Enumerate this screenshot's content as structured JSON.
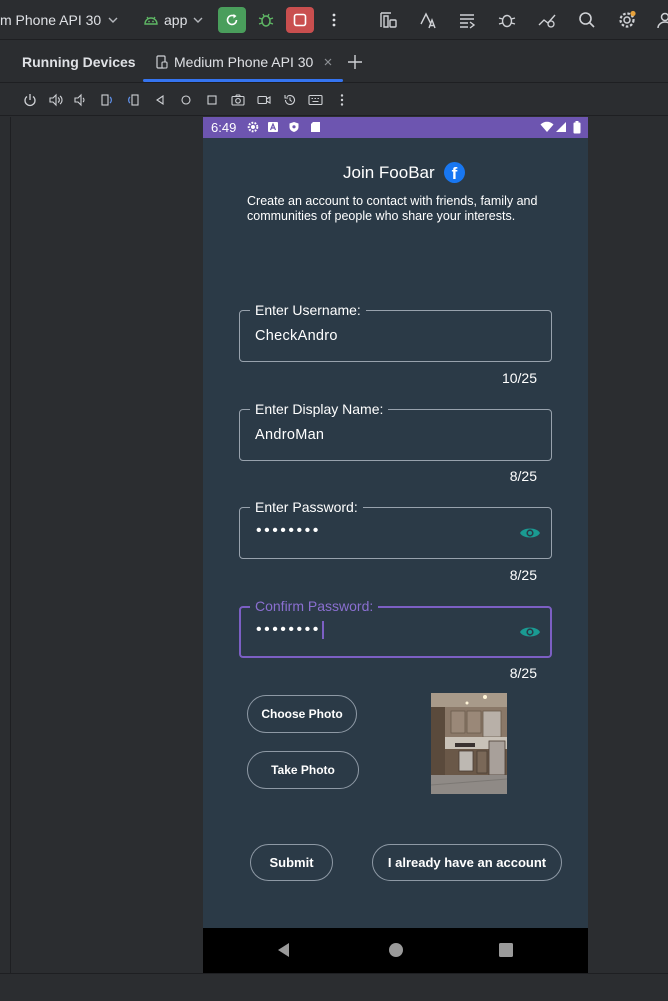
{
  "toolbar": {
    "device_selector": "m Phone API 30",
    "run_config": "app"
  },
  "panel": {
    "title": "Running Devices",
    "tab_label": "Medium Phone API 30"
  },
  "status_bar": {
    "time": "6:49"
  },
  "app": {
    "title": "Join FooBar",
    "subtitle": "Create an account to contact with friends, family and communities of people who share your interests.",
    "fields": {
      "username": {
        "label": "Enter Username:",
        "value": "CheckAndro",
        "counter": "10/25"
      },
      "display_name": {
        "label": "Enter Display Name:",
        "value": "AndroMan",
        "counter": "8/25"
      },
      "password": {
        "label": "Enter Password:",
        "value": "••••••••",
        "counter": "8/25"
      },
      "confirm_password": {
        "label": "Confirm Password:",
        "value": "••••••••",
        "counter": "8/25"
      }
    },
    "buttons": {
      "choose_photo": "Choose Photo",
      "take_photo": "Take Photo",
      "submit": "Submit",
      "have_account": "I already have an account"
    }
  },
  "colors": {
    "ide_background": "#2b2d30",
    "app_background": "#2b3a47",
    "status_bar": "#6d55b0",
    "accent_focus": "#7c5fc4",
    "eye_icon": "#1a9a92",
    "run_button": "#4a9e5c",
    "stop_button": "#c94f4f",
    "tab_underline": "#3574f0"
  }
}
